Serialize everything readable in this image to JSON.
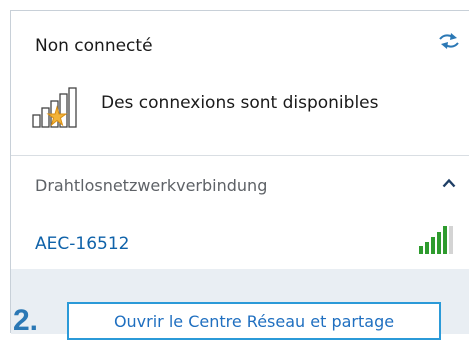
{
  "status": {
    "title": "Non connecté",
    "availability_text": "Des connexions sont disponibles",
    "refresh_icon": "refresh-arrows-icon",
    "signal_icon": "signal-bars-with-star-icon"
  },
  "wireless": {
    "adapter_name": "Drahtlosnetzwerkverbindung",
    "collapse_icon": "chevron-up-icon",
    "networks": [
      {
        "ssid": "AEC-16512",
        "signal_icon": "wifi-signal-full-icon"
      }
    ]
  },
  "footer": {
    "step_label": "2.",
    "open_center_label": "Ouvrir le Centre Réseau et partage"
  },
  "colors": {
    "link_blue": "#0f62a9",
    "highlight_border": "#2b9ad8",
    "step_blue": "#2b78b5",
    "footer_bg": "#e9eef3",
    "signal_green": "#2e9b2e"
  }
}
